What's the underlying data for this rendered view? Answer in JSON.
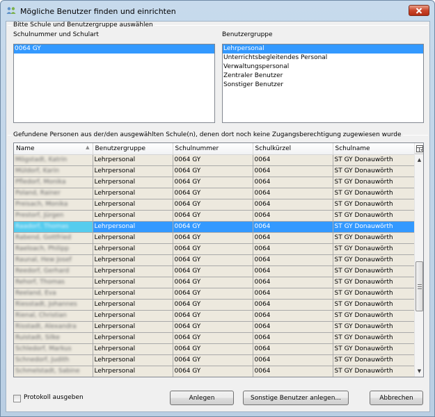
{
  "window": {
    "title": "Mögliche Benutzer finden und einrichten"
  },
  "selection_group": {
    "label": "Bitte Schule und Benutzergruppe auswählen",
    "schools": {
      "label": "Schulnummer und Schulart",
      "items": [
        "0064 GY"
      ],
      "selected": 0
    },
    "user_groups": {
      "label": "Benutzergruppe",
      "items": [
        "Lehrpersonal",
        "Unterrichtsbegleitendes Personal",
        "Verwaltungspersonal",
        "Zentraler Benutzer",
        "Sonstiger Benutzer"
      ],
      "selected": 0
    }
  },
  "results_group": {
    "label": "Gefundene Personen aus der/den ausgewählten Schule(n), denen dort noch keine Zugangsberechtigung zugewiesen wurde"
  },
  "grid": {
    "columns": [
      "Name",
      "Benutzergruppe",
      "Schulnummer",
      "Schulkürzel",
      "Schulname"
    ],
    "selected_row": 6,
    "rows": [
      [
        "Mögstadt, Katrin",
        "Lehrpersonal",
        "0064 GY",
        "0064",
        "ST GY Donauwörth"
      ],
      [
        "Müldorf, Karin",
        "Lehrpersonal",
        "0064 GY",
        "0064",
        "ST GY Donauwörth"
      ],
      [
        "Pfledorf, Monika",
        "Lehrpersonal",
        "0064 GY",
        "0064",
        "ST GY Donauwörth"
      ],
      [
        "Poland, Rainer",
        "Lehrpersonal",
        "0064 GY",
        "0064",
        "ST GY Donauwörth"
      ],
      [
        "Preisach, Monika",
        "Lehrpersonal",
        "0064 GY",
        "0064",
        "ST GY Donauwörth"
      ],
      [
        "Prestorf, Jürgen",
        "Lehrpersonal",
        "0064 GY",
        "0064",
        "ST GY Donauwörth"
      ],
      [
        "Raadorf, Thomas",
        "Lehrpersonal",
        "0064 GY",
        "0064",
        "ST GY Donauwörth"
      ],
      [
        "Rabend, Gottfried",
        "Lehrpersonal",
        "0064 GY",
        "0064",
        "ST GY Donauwörth"
      ],
      [
        "Raeloach, Philipp",
        "Lehrpersonal",
        "0064 GY",
        "0064",
        "ST GY Donauwörth"
      ],
      [
        "Raunal, Hew Josef",
        "Lehrpersonal",
        "0064 GY",
        "0064",
        "ST GY Donauwörth"
      ],
      [
        "Reedorf, Gerhard",
        "Lehrpersonal",
        "0064 GY",
        "0064",
        "ST GY Donauwörth"
      ],
      [
        "Rehorf, Thomas",
        "Lehrpersonal",
        "0064 GY",
        "0064",
        "ST GY Donauwörth"
      ],
      [
        "Reeland, Eva",
        "Lehrpersonal",
        "0064 GY",
        "0064",
        "ST GY Donauwörth"
      ],
      [
        "Riesstadt, Johannes",
        "Lehrpersonal",
        "0064 GY",
        "0064",
        "ST GY Donauwörth"
      ],
      [
        "Rienal, Christian",
        "Lehrpersonal",
        "0064 GY",
        "0064",
        "ST GY Donauwörth"
      ],
      [
        "Risstadt, Alexandra",
        "Lehrpersonal",
        "0064 GY",
        "0064",
        "ST GY Donauwörth"
      ],
      [
        "Ruistadt, Silke",
        "Lehrpersonal",
        "0064 GY",
        "0064",
        "ST GY Donauwörth"
      ],
      [
        "Schledorf, Markus",
        "Lehrpersonal",
        "0064 GY",
        "0064",
        "ST GY Donauwörth"
      ],
      [
        "Schnedorf, Judith",
        "Lehrpersonal",
        "0064 GY",
        "0064",
        "ST GY Donauwörth"
      ],
      [
        "Schmelstadt, Sabine",
        "Lehrpersonal",
        "0064 GY",
        "0064",
        "ST GY Donauwörth"
      ]
    ]
  },
  "footer": {
    "protocol_checkbox": {
      "label": "Protokoll ausgeben",
      "checked": false
    },
    "create_button": "Anlegen",
    "create_other_button": "Sonstige Benutzer anlegen...",
    "cancel_button": "Abbrechen"
  },
  "icons": {
    "window_icon": "users-icon",
    "close": "close-icon",
    "sort": "sort-ascending-icon",
    "column_chooser": "column-chooser-icon",
    "scroll_up": "arrow-up-icon",
    "scroll_down": "arrow-down-icon"
  },
  "colors": {
    "selection": "#3399ff",
    "row_background": "#ede9de",
    "close_button": "#c9452a"
  }
}
